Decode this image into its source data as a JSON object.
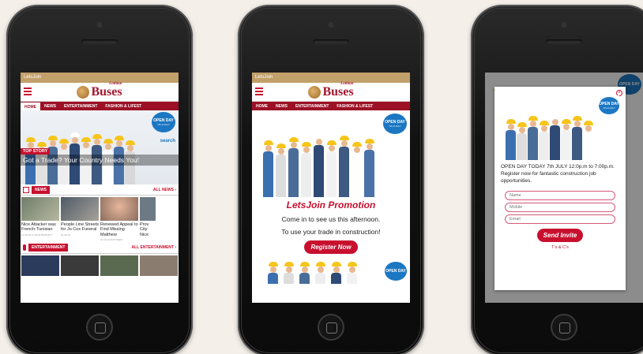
{
  "phone1": {
    "topbar": "LetsJoin",
    "logo_text": "Buses",
    "logo_sub": "Lothian",
    "nav": [
      "HOME",
      "NEWS",
      "ENTERTAINMENT",
      "FASHION & LIFEST"
    ],
    "hero_tag": "TOP STORY",
    "hero_caption": "Got a Trade? Your Country Needs You!",
    "bubble_title": "OPEN DAY",
    "bubble_sub": "7th of JULY",
    "search_brand": "search",
    "news_label": "NEWS",
    "all_news": "ALL NEWS ›",
    "news": [
      {
        "title": "Nice Attacker was French-Tunisian",
        "meta": "10-10-15 11:00:00 BURNETT"
      },
      {
        "title": "People Line Streets for Jo Cox Funeral",
        "meta": "10-10-15"
      },
      {
        "title": "Renewed Appeal to Find Missing Matthew",
        "meta": "10-10-15 MATTHEW"
      },
      {
        "title": "Prov City Nice",
        "meta": ""
      }
    ],
    "ent_label": "ENTERTAINMENT",
    "all_ent": "ALL ENTERTAINMENT ›"
  },
  "phone2": {
    "topbar": "LetsJoin",
    "logo_text": "Buses",
    "logo_sub": "Lothian",
    "nav": [
      "HOME",
      "NEWS",
      "ENTERTAINMENT",
      "FASHION & LIFEST"
    ],
    "bubble_title": "OPEN DAY",
    "bubble_sub": "7th of JULY",
    "promo_title": "LetsJoin Promotion",
    "line1": "Come in to see us this afternoon.",
    "line2": "To use your trade in construction!",
    "button": "Register Now"
  },
  "phone3": {
    "close": "×",
    "bubble_title": "OPEN DAY",
    "bubble_sub": "7th of JULY",
    "text1": "OPEN DAY TODAY 7th JULY 12:0p.m to 7:00p.m.",
    "text2": "Register now for fantastic construction job opportunities.",
    "name_ph": "Name",
    "mobile_ph": "Mobile",
    "email_ph": "Email",
    "button": "Send Invite",
    "tc": "T's & C's"
  },
  "colors": {
    "brand_red": "#c8102e",
    "nav_red": "#9c1126",
    "gold": "#c2a06a",
    "bubble_blue": "#1c77c3"
  }
}
